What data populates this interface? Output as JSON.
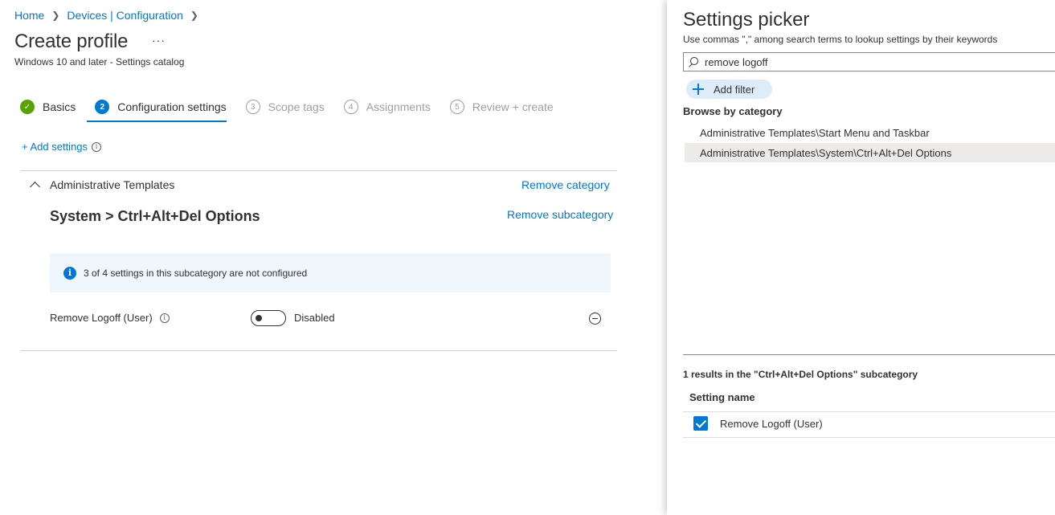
{
  "breadcrumb": {
    "home": "Home",
    "devices": "Devices | Configuration"
  },
  "page": {
    "title": "Create profile",
    "more": "···",
    "subtitle": "Windows 10 and later - Settings catalog"
  },
  "steps": [
    {
      "num": "✓",
      "label": "Basics",
      "state": "done"
    },
    {
      "num": "2",
      "label": "Configuration settings",
      "state": "active"
    },
    {
      "num": "3",
      "label": "Scope tags",
      "state": "todo"
    },
    {
      "num": "4",
      "label": "Assignments",
      "state": "todo"
    },
    {
      "num": "5",
      "label": "Review + create",
      "state": "todo"
    }
  ],
  "add_settings": {
    "label": "+ Add settings",
    "info": "i"
  },
  "category": {
    "name": "Administrative Templates",
    "remove_label": "Remove category",
    "subcategory_title": "System > Ctrl+Alt+Del Options",
    "remove_sub_label": "Remove subcategory",
    "info_icon": "i",
    "info_text": "3 of 4 settings in this subcategory are not configured",
    "setting": {
      "label": "Remove Logoff (User)",
      "info": "i",
      "toggle_state": "Disabled"
    }
  },
  "picker": {
    "title": "Settings picker",
    "description": "Use commas \",\" among search terms to lookup settings by their keywords",
    "search_value": "remove logoff",
    "add_filter": "Add filter",
    "browse_title": "Browse by category",
    "categories": [
      "Administrative Templates\\Start Menu and Taskbar",
      "Administrative Templates\\System\\Ctrl+Alt+Del Options"
    ],
    "results_title": "1 results in the \"Ctrl+Alt+Del Options\" subcategory",
    "column_header": "Setting name",
    "results": [
      "Remove Logoff (User)"
    ]
  },
  "colors": {
    "accent": "#0078d4",
    "success": "#57a300",
    "info_bg": "#eff6fc",
    "selected_bg": "#edebe9"
  }
}
